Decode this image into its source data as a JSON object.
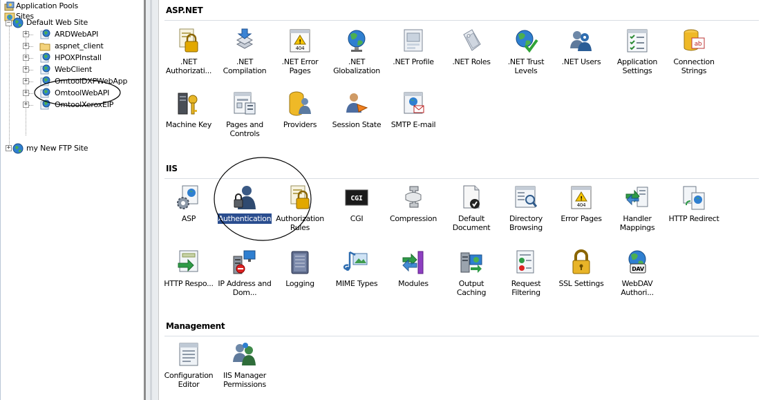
{
  "tree": {
    "app_pools": "Application Pools",
    "sites": "Sites",
    "default_site": "Default Web Site",
    "children": [
      "ARDWebAPI",
      "aspnet_client",
      "HPOXPInstall",
      "WebClient",
      "OmtoolDXPWebApp",
      "OmtoolWebAPI",
      "OmtoolXeroxEIP"
    ],
    "ftp_site": "my New FTP Site"
  },
  "groups": {
    "aspnet": {
      "title": "ASP.NET",
      "items": [
        {
          "label": ".NET Authorizati...",
          "icon": "lock-document-icon"
        },
        {
          "label": ".NET Compilation",
          "icon": "compilation-icon"
        },
        {
          "label": ".NET Error Pages",
          "icon": "error-page-404-icon"
        },
        {
          "label": ".NET Globalization",
          "icon": "globe-icon"
        },
        {
          "label": ".NET Profile",
          "icon": "profile-page-icon"
        },
        {
          "label": ".NET Roles",
          "icon": "tag-icon"
        },
        {
          "label": ".NET Trust Levels",
          "icon": "globe-check-icon"
        },
        {
          "label": ".NET Users",
          "icon": "users-icon"
        },
        {
          "label": "Application Settings",
          "icon": "settings-list-icon"
        },
        {
          "label": "Connection Strings",
          "icon": "database-ab-icon"
        },
        {
          "label": "Machine Key",
          "icon": "key-icon"
        },
        {
          "label": "Pages and Controls",
          "icon": "pages-controls-icon"
        },
        {
          "label": "Providers",
          "icon": "providers-icon"
        },
        {
          "label": "Session State",
          "icon": "session-state-icon"
        },
        {
          "label": "SMTP E-mail",
          "icon": "email-icon"
        }
      ]
    },
    "iis": {
      "title": "IIS",
      "items": [
        {
          "label": "ASP",
          "icon": "asp-gear-icon"
        },
        {
          "label": "Authentication",
          "icon": "user-lock-icon",
          "selected": true
        },
        {
          "label": "Authorization Rules",
          "icon": "lock-document-icon"
        },
        {
          "label": "CGI",
          "icon": "cgi-icon"
        },
        {
          "label": "Compression",
          "icon": "compression-clamp-icon"
        },
        {
          "label": "Default Document",
          "icon": "default-document-icon"
        },
        {
          "label": "Directory Browsing",
          "icon": "directory-browsing-icon"
        },
        {
          "label": "Error Pages",
          "icon": "error-page-404-icon"
        },
        {
          "label": "Handler Mappings",
          "icon": "handler-mappings-icon"
        },
        {
          "label": "HTTP Redirect",
          "icon": "http-redirect-icon"
        },
        {
          "label": "HTTP Respo...",
          "icon": "http-response-icon"
        },
        {
          "label": "IP Address and Dom...",
          "icon": "ip-address-icon"
        },
        {
          "label": "Logging",
          "icon": "logging-icon"
        },
        {
          "label": "MIME Types",
          "icon": "mime-types-icon"
        },
        {
          "label": "Modules",
          "icon": "modules-icon"
        },
        {
          "label": "Output Caching",
          "icon": "output-caching-icon"
        },
        {
          "label": "Request Filtering",
          "icon": "request-filtering-icon"
        },
        {
          "label": "SSL Settings",
          "icon": "padlock-icon"
        },
        {
          "label": "WebDAV Authori...",
          "icon": "webdav-icon"
        }
      ]
    },
    "management": {
      "title": "Management",
      "items": [
        {
          "label": "Configuration Editor",
          "icon": "config-editor-icon"
        },
        {
          "label": "IIS Manager Permissions",
          "icon": "manager-permissions-icon"
        }
      ]
    }
  },
  "colors": {
    "selection": "#2a4d8f",
    "annotation_circle": "#000000",
    "splitter": "#8c8c8c"
  }
}
